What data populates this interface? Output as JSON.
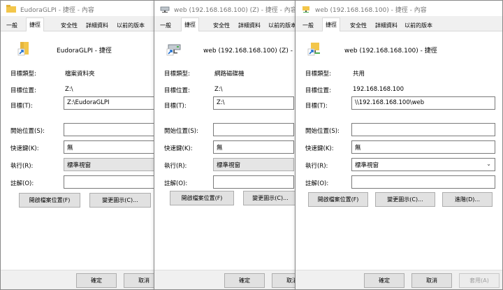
{
  "tabs": [
    "一般",
    "捷徑",
    "安全性",
    "詳細資料",
    "以前的版本"
  ],
  "labels": {
    "target_type": "目標類型:",
    "target_location": "目標位置:",
    "target": "目標(T):",
    "start_in": "開始位置(S):",
    "shortcut_key": "快速鍵(K):",
    "run": "執行(R):",
    "comment": "註解(O):"
  },
  "buttons": {
    "open_location": "開啟檔案位置(F)",
    "change_icon": "變更圖示(C)...",
    "advanced": "進階(D)...",
    "ok": "確定",
    "cancel": "取消",
    "apply": "套用(A)"
  },
  "dialog1": {
    "title": "EudoraGLPI - 捷徑 - 內容",
    "name": "EudoraGLPI - 捷徑",
    "target_type": "檔案資料夾",
    "target_location": "Z:\\",
    "target": "Z:\\EudoraGLPI",
    "start_in": "",
    "shortcut_key": "無",
    "run": "標準視窗",
    "comment": ""
  },
  "dialog2": {
    "title": "web (192.168.168.100) (Z) - 捷徑 - 內容",
    "name": "web (192.168.168.100) (Z) - 捷徑",
    "target_type": "網路磁碟機",
    "target_location": "Z:\\",
    "target": "Z:\\",
    "start_in": "",
    "shortcut_key": "無",
    "run": "標準視窗",
    "comment": ""
  },
  "dialog3": {
    "title": "web (192.168.168.100) - 捷徑 - 內容",
    "name": "web (192.168.168.100) - 捷徑",
    "target_type": "共用",
    "target_location": "192.168.168.100",
    "target": "\\\\192.168.168.100\\web",
    "start_in": "",
    "shortcut_key": "無",
    "run": "標準視窗",
    "comment": ""
  },
  "icons": {
    "folder_shortcut": "folder-shortcut-icon",
    "drive_shortcut": "network-drive-shortcut-icon",
    "share_shortcut": "network-share-shortcut-icon"
  },
  "colors": {
    "desktop": "#2a5a86",
    "folder": "#f3c64a",
    "shortcut_arrow": "#1e6fd0",
    "dialog_bg": "#ffffff",
    "button_bg": "#e1e1e1"
  }
}
